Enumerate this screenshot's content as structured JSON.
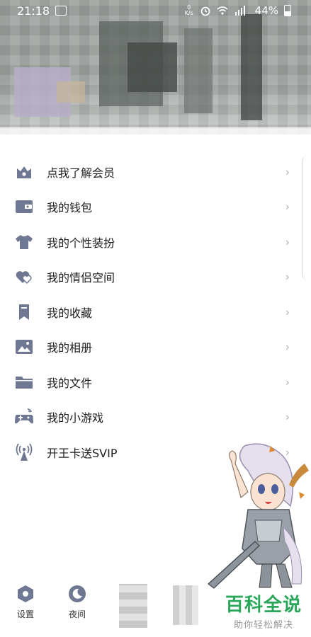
{
  "status_bar": {
    "time": "21:18",
    "net_speed": "0 K/s",
    "battery": "44%"
  },
  "menu": {
    "items": [
      {
        "label": "点我了解会员",
        "icon": "crown-icon"
      },
      {
        "label": "我的钱包",
        "icon": "wallet-icon"
      },
      {
        "label": "我的个性装扮",
        "icon": "tshirt-icon"
      },
      {
        "label": "我的情侣空间",
        "icon": "couple-hearts-icon"
      },
      {
        "label": "我的收藏",
        "icon": "bookmark-icon"
      },
      {
        "label": "我的相册",
        "icon": "photo-album-icon"
      },
      {
        "label": "我的文件",
        "icon": "folder-icon"
      },
      {
        "label": "我的小游戏",
        "icon": "gamepad-icon"
      },
      {
        "label": "开王卡送SVIP",
        "icon": "signal-tower-icon"
      }
    ],
    "chevron": "›"
  },
  "bottom_bar": {
    "settings_label": "设置",
    "night_label": "夜间"
  },
  "watermark": {
    "title": "百科全说",
    "subtitle": "助你轻松解决"
  },
  "colors": {
    "icon": "#6e7892",
    "text": "#1f1f1f",
    "chevron": "#b3b3b3",
    "watermark": "#2aa75a"
  }
}
